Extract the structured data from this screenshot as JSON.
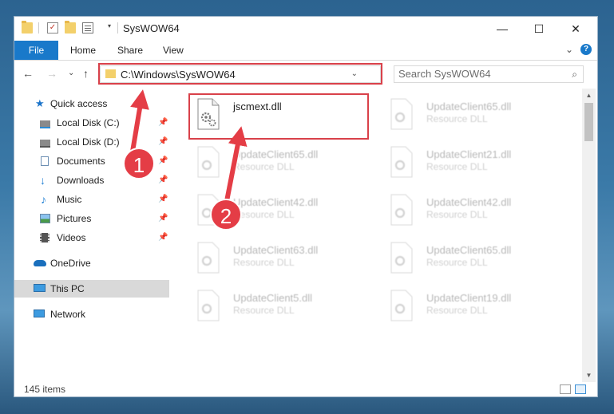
{
  "window": {
    "title": "SysWOW64",
    "minimize": "—",
    "maximize": "☐",
    "close": "✕"
  },
  "ribbon": {
    "tabs": [
      "File",
      "Home",
      "Share",
      "View"
    ],
    "expand": "⌄",
    "help": "?"
  },
  "nav": {
    "back": "←",
    "forward": "→",
    "recent": "⌄",
    "up": "↑",
    "address": "C:\\Windows\\SysWOW64",
    "address_dropdown": "⌄",
    "refresh": "↻",
    "search_placeholder": "Search SysWOW64",
    "search_icon": "⌕"
  },
  "sidebar": {
    "items": [
      {
        "label": "Quick access",
        "icon": "star-icon",
        "pinned": false
      },
      {
        "label": "Local Disk (C:)",
        "icon": "drive-icon",
        "pinned": true
      },
      {
        "label": "Local Disk (D:)",
        "icon": "drive-icon",
        "pinned": true
      },
      {
        "label": "Documents",
        "icon": "documents-icon",
        "pinned": true
      },
      {
        "label": "Downloads",
        "icon": "download-icon",
        "pinned": true
      },
      {
        "label": "Music",
        "icon": "music-icon",
        "pinned": true
      },
      {
        "label": "Pictures",
        "icon": "pictures-icon",
        "pinned": true
      },
      {
        "label": "Videos",
        "icon": "videos-icon",
        "pinned": true
      },
      {
        "label": "OneDrive",
        "icon": "cloud-icon",
        "pinned": false
      },
      {
        "label": "This PC",
        "icon": "computer-icon",
        "pinned": false,
        "selected": true
      },
      {
        "label": "Network",
        "icon": "network-icon",
        "pinned": false
      }
    ],
    "pin_glyph": "📌"
  },
  "files": [
    {
      "name": "jscmext.dll",
      "type": "",
      "highlighted": true
    },
    {
      "name": "UpdateClient65.dll",
      "type": "Resource DLL"
    },
    {
      "name": "UpdateClient65.dll",
      "type": "Resource DLL"
    },
    {
      "name": "UpdateClient21.dll",
      "type": "Resource DLL"
    },
    {
      "name": "UpdateClient42.dll",
      "type": "Resource DLL"
    },
    {
      "name": "UpdateClient42.dll",
      "type": "Resource DLL"
    },
    {
      "name": "UpdateClient63.dll",
      "type": "Resource DLL"
    },
    {
      "name": "UpdateClient65.dll",
      "type": "Resource DLL"
    },
    {
      "name": "UpdateClient5.dll",
      "type": "Resource DLL"
    },
    {
      "name": "UpdateClient19.dll",
      "type": "Resource DLL"
    }
  ],
  "status": {
    "item_count": "145 items"
  },
  "annotations": {
    "step1": "1",
    "step2": "2",
    "accent": "#e43d46"
  },
  "colors": {
    "file_tab": "#1979ca",
    "selection": "#d9d9d9",
    "highlight_box": "#d9414a"
  }
}
